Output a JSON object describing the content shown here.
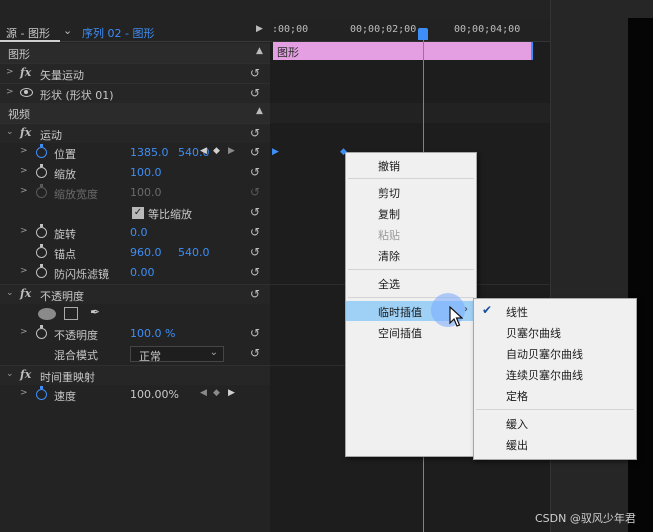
{
  "source_header": {
    "title": "源 - 图形",
    "sequence": "序列 02 - 图形"
  },
  "timeline": {
    "timecodes": [
      ":00;00",
      "00;00;02;00",
      "00;00;04;00"
    ],
    "clip_label": "图形"
  },
  "sections": {
    "graphics": "图形",
    "video": "视频"
  },
  "effects": {
    "vector_motion": "矢量运动",
    "shape": "形状 (形状 01)",
    "motion": "运动",
    "position_label": "位置",
    "position_x": "1385.0",
    "position_y": "540.0",
    "scale_label": "缩放",
    "scale_value": "100.0",
    "scale_width_label": "缩放宽度",
    "scale_width_value": "100.0",
    "uniform_scale_label": "等比缩放",
    "rotation_label": "旋转",
    "rotation_value": "0.0",
    "anchor_label": "锚点",
    "anchor_x": "960.0",
    "anchor_y": "540.0",
    "antiflicker_label": "防闪烁滤镜",
    "antiflicker_value": "0.00",
    "opacity_group": "不透明度",
    "opacity_label": "不透明度",
    "opacity_value": "100.0 %",
    "blend_label": "混合模式",
    "blend_value": "正常",
    "time_remap": "时间重映射",
    "speed_label": "速度",
    "speed_value": "100.00%"
  },
  "context_menu": {
    "undo": "撤销",
    "cut": "剪切",
    "copy": "复制",
    "paste": "粘贴",
    "clear": "清除",
    "select_all": "全选",
    "temporal_interp": "临时插值",
    "spatial_interp": "空间插值"
  },
  "submenu": {
    "linear": "线性",
    "bezier": "贝塞尔曲线",
    "auto_bezier": "自动贝塞尔曲线",
    "continuous_bezier": "连续贝塞尔曲线",
    "hold": "定格",
    "ease_in": "缓入",
    "ease_out": "缓出"
  },
  "watermark": "CSDN @驭风少年君",
  "colors": {
    "accent_blue": "#3e8ef7",
    "clip_pink": "#e39fe1",
    "menu_highlight": "#9fd0f5"
  }
}
